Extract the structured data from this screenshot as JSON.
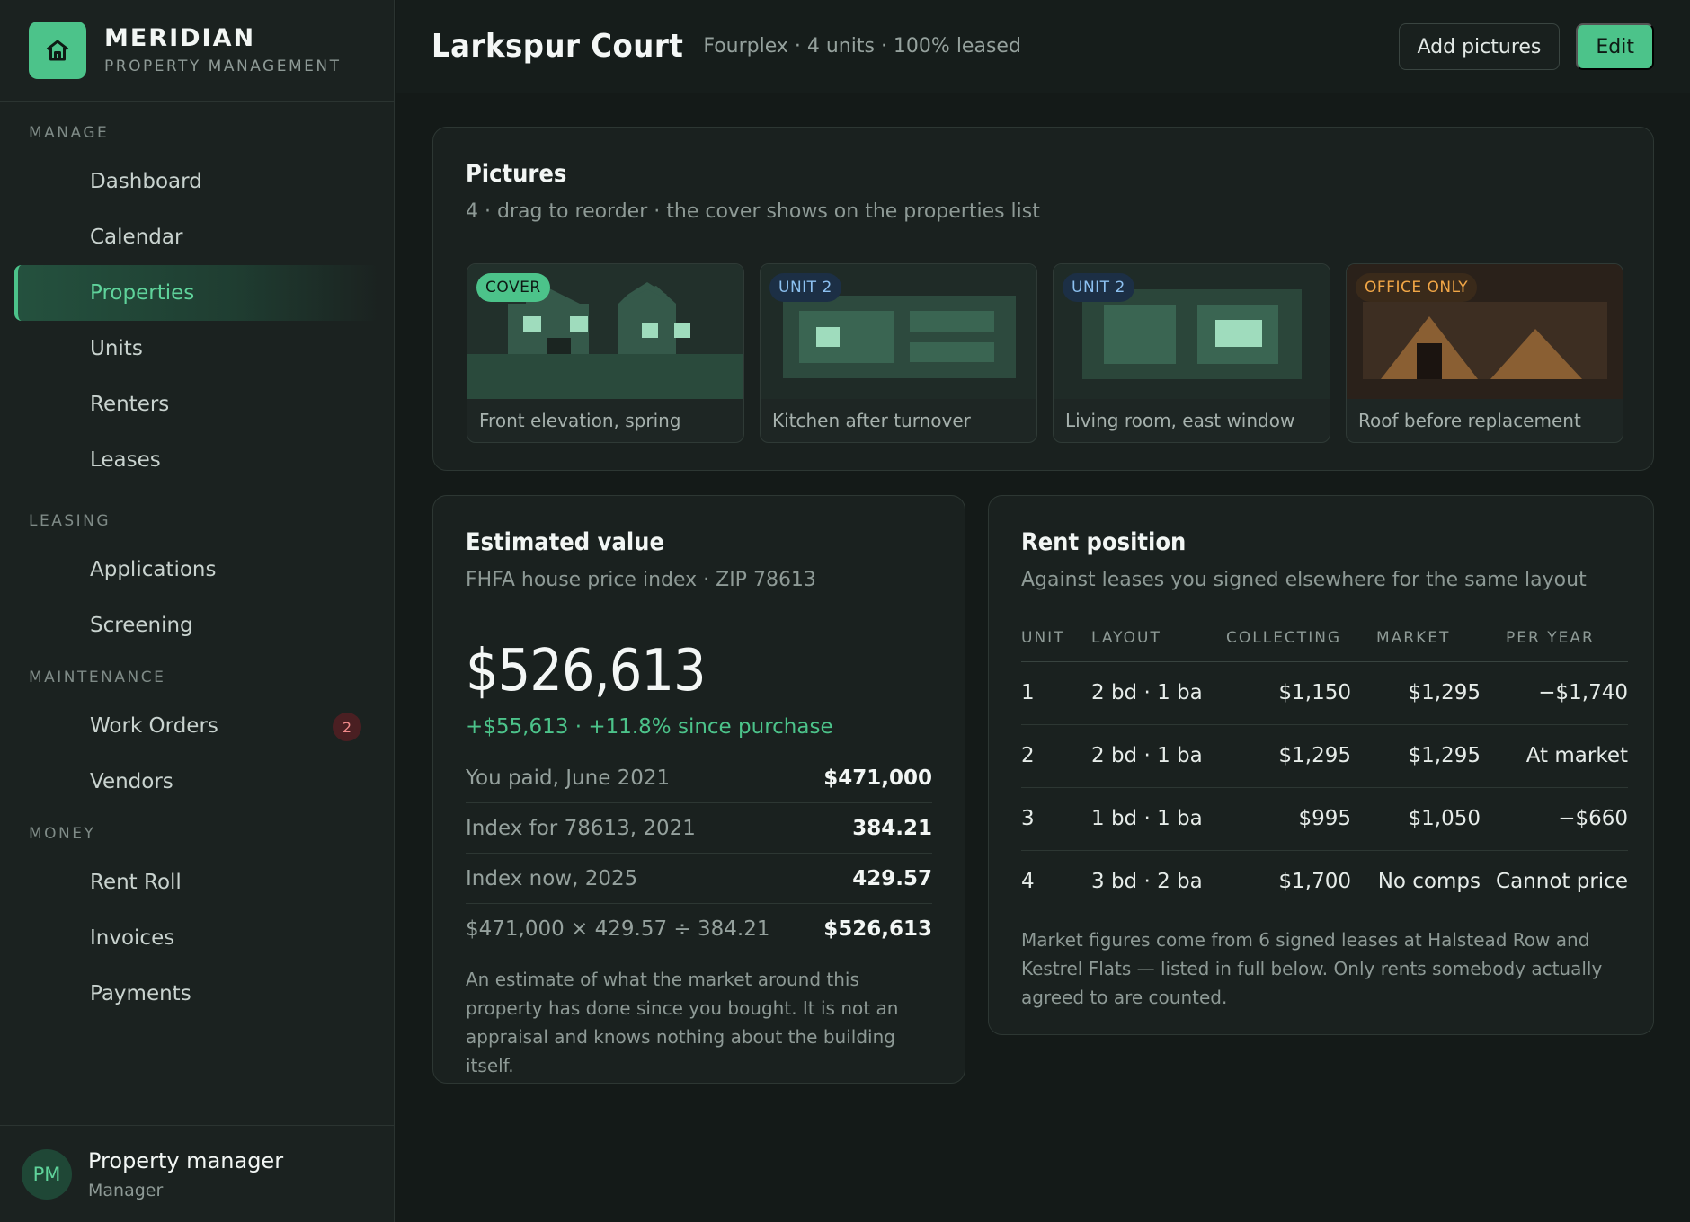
{
  "brand": {
    "name": "MERIDIAN",
    "subtitle": "PROPERTY MANAGEMENT",
    "logo_icon": "home-icon"
  },
  "nav": [
    {
      "section": "MANAGE",
      "items": [
        {
          "label": "Dashboard"
        },
        {
          "label": "Calendar"
        },
        {
          "label": "Properties",
          "active": true
        },
        {
          "label": "Units"
        },
        {
          "label": "Renters"
        },
        {
          "label": "Leases"
        }
      ]
    },
    {
      "section": "LEASING",
      "items": [
        {
          "label": "Applications"
        },
        {
          "label": "Screening"
        }
      ]
    },
    {
      "section": "MAINTENANCE",
      "items": [
        {
          "label": "Work Orders",
          "badge": "2"
        },
        {
          "label": "Vendors"
        }
      ]
    },
    {
      "section": "MONEY",
      "items": [
        {
          "label": "Rent Roll"
        },
        {
          "label": "Invoices"
        },
        {
          "label": "Payments"
        }
      ]
    }
  ],
  "user": {
    "initials": "PM",
    "name": "Property manager",
    "role": "Manager"
  },
  "header": {
    "title": "Larkspur Court",
    "subtitle": "Fourplex · 4 units · 100% leased",
    "add_pictures_label": "Add pictures",
    "edit_label": "Edit"
  },
  "pictures": {
    "title": "Pictures",
    "subtitle": "4 · drag to reorder · the cover shows on the properties list",
    "items": [
      {
        "tag": "COVER",
        "caption": "Front elevation, spring"
      },
      {
        "tag": "UNIT 2",
        "caption": "Kitchen after turnover"
      },
      {
        "tag": "UNIT 2",
        "caption": "Living room, east window"
      },
      {
        "tag": "OFFICE ONLY",
        "caption": "Roof before replacement"
      }
    ]
  },
  "estimate": {
    "title": "Estimated value",
    "subtitle": "FHFA house price index · ZIP 78613",
    "value": "$526,613",
    "change": "+$55,613 · +11.8% since purchase",
    "rows": [
      {
        "label": "You paid, June 2021",
        "value": "$471,000"
      },
      {
        "label": "Index for 78613, 2021",
        "value": "384.21"
      },
      {
        "label": "Index now, 2025",
        "value": "429.57"
      },
      {
        "label": "$471,000 × 429.57 ÷ 384.21",
        "value": "$526,613"
      }
    ],
    "note": "An estimate of what the market around this property has done since you bought. It is not an appraisal and knows nothing about the building itself."
  },
  "rent": {
    "title": "Rent position",
    "subtitle": "Against leases you signed elsewhere for the same layout",
    "columns": [
      "UNIT",
      "LAYOUT",
      "COLLECTING",
      "MARKET",
      "PER YEAR"
    ],
    "rows": [
      {
        "unit": "1",
        "layout": "2 bd · 1 ba",
        "collecting": "$1,150",
        "market": "$1,295",
        "per_year": "−$1,740",
        "negative": true
      },
      {
        "unit": "2",
        "layout": "2 bd · 1 ba",
        "collecting": "$1,295",
        "market": "$1,295",
        "per_year": "At market",
        "negative": false
      },
      {
        "unit": "3",
        "layout": "1 bd · 1 ba",
        "collecting": "$995",
        "market": "$1,050",
        "per_year": "−$660",
        "negative": true
      },
      {
        "unit": "4",
        "layout": "3 bd · 2 ba",
        "collecting": "$1,700",
        "market": "No comps",
        "per_year": "Cannot price",
        "negative": false
      }
    ],
    "note": "Market figures come from 6 signed leases at Halstead Row and Kestrel Flats — listed in full below. Only rents somebody actually agreed to are counted."
  },
  "colors": {
    "accent": "#4cc38a",
    "warning": "#f1a646",
    "background": "#141a18"
  }
}
